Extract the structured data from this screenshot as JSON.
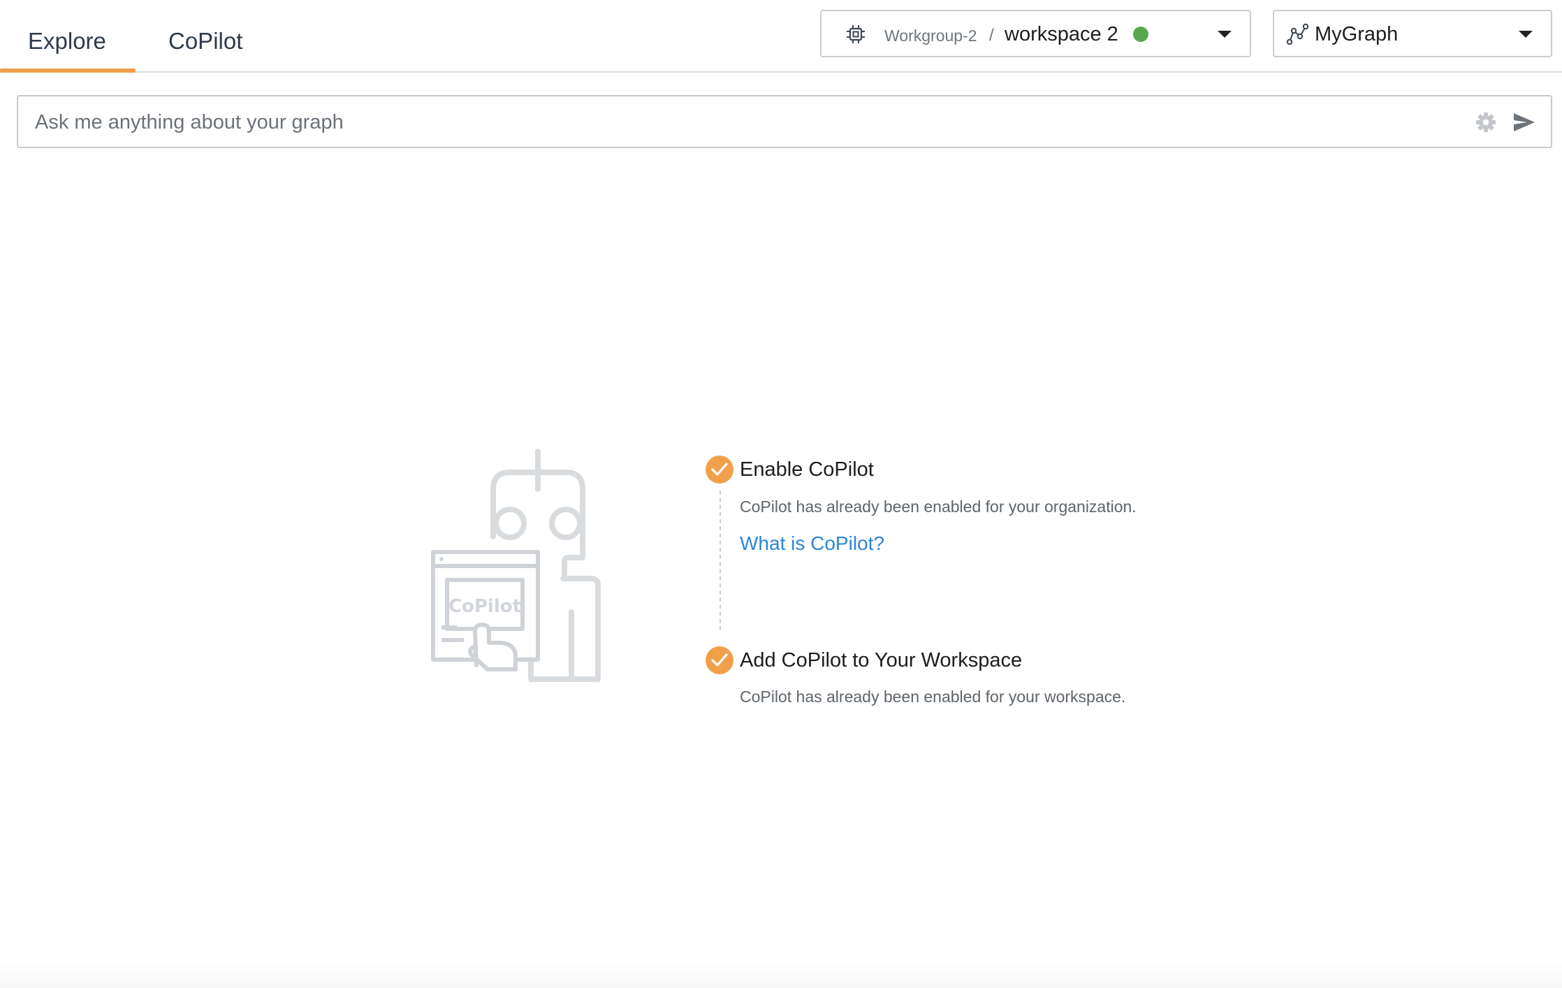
{
  "tabs": [
    {
      "label": "Explore",
      "active": true
    },
    {
      "label": "CoPilot",
      "active": false
    }
  ],
  "workspace_selector": {
    "group": "Workgroup-2",
    "separator": "/",
    "workspace": "workspace 2",
    "icon": "cpu-chip-icon",
    "status_color": "#5aa552"
  },
  "graph_selector": {
    "name": "MyGraph",
    "icon": "graph-icon"
  },
  "search": {
    "placeholder": "Ask me anything about your graph",
    "value": ""
  },
  "illustration": {
    "label": "CoPilot"
  },
  "steps": [
    {
      "title": "Enable CoPilot",
      "description": "CoPilot has already been enabled for your organization.",
      "link": "What is CoPilot?",
      "completed": true
    },
    {
      "title": "Add CoPilot to Your Workspace",
      "description": "CoPilot has already been enabled for your workspace.",
      "completed": true
    }
  ],
  "colors": {
    "accent": "#f0a04b",
    "link": "#2b86d4",
    "status_ok": "#5aa552"
  }
}
